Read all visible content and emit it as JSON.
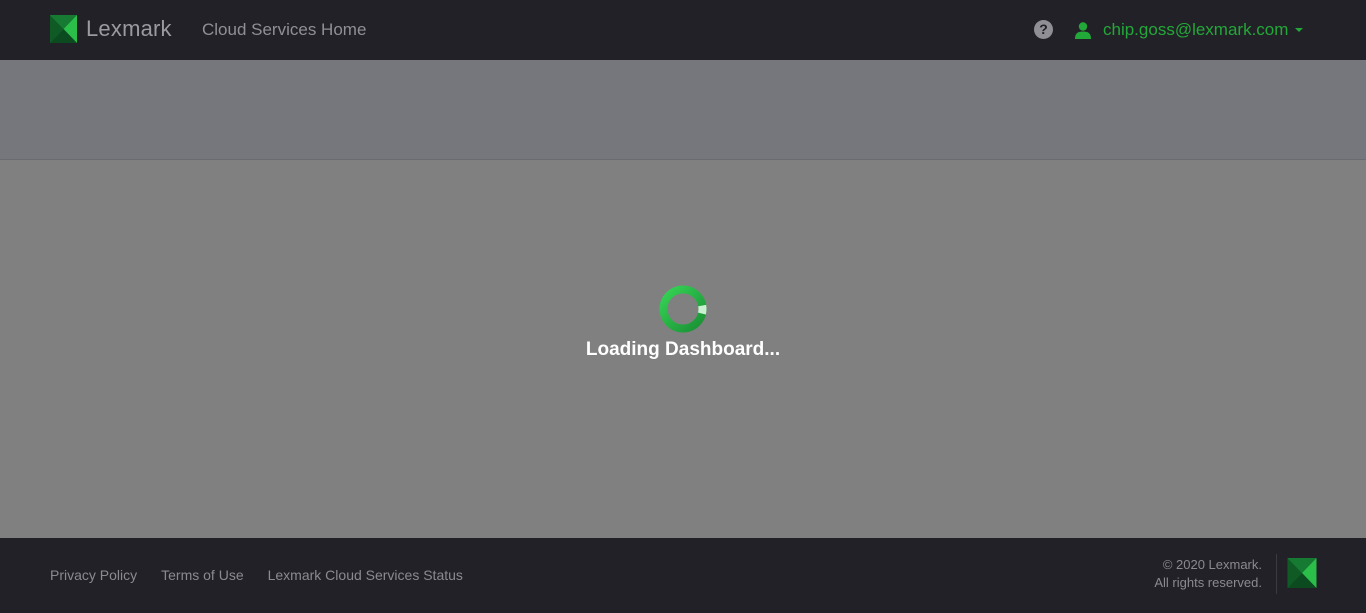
{
  "header": {
    "brand": "Lexmark",
    "app_title": "Cloud Services Home",
    "help_icon": "?",
    "user_email": "chip.goss@lexmark.com"
  },
  "main": {
    "loading_text": "Loading Dashboard..."
  },
  "footer": {
    "links": [
      "Privacy Policy",
      "Terms of Use",
      "Lexmark Cloud Services Status"
    ],
    "copyright_line1": "© 2020 Lexmark.",
    "copyright_line2": "All rights reserved."
  },
  "colors": {
    "topbar_bg": "#222127",
    "accent_green": "#22a838",
    "overlay_gray": "#808080"
  },
  "icons": [
    "lexmark-logo-icon",
    "help-icon",
    "user-icon",
    "chevron-down-icon",
    "spinner-icon"
  ]
}
